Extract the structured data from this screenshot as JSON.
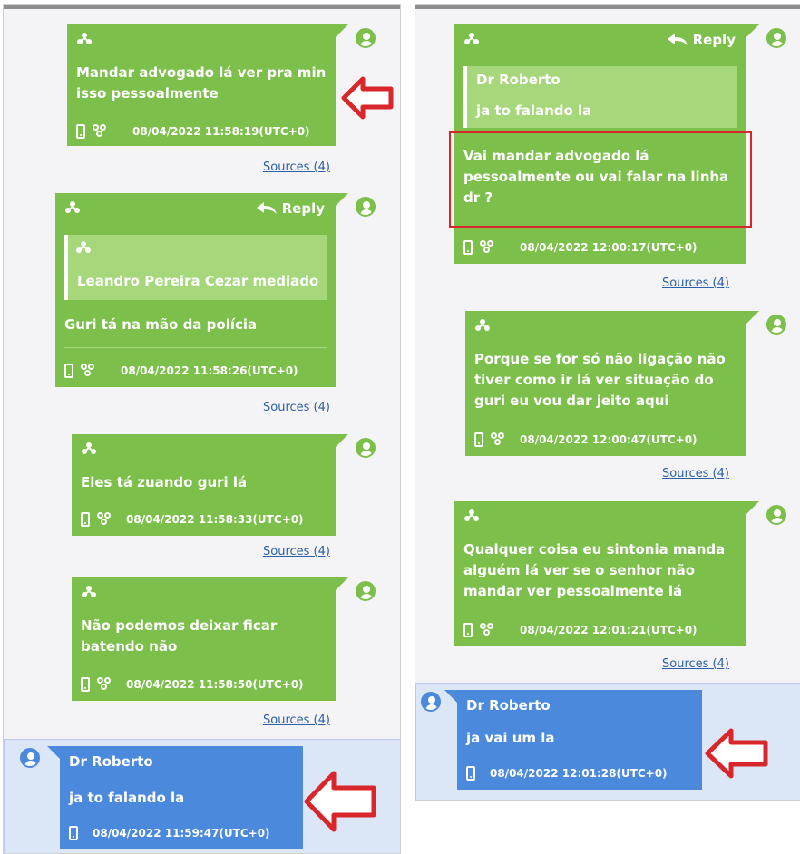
{
  "left_messages": [
    {
      "text": "Mandar advogado lá ver pra min isso pessoalmente",
      "time": "08/04/2022 11:58:19(UTC+0)",
      "sources": "Sources (4)"
    },
    {
      "reply_label": "Reply",
      "quote_name": "Leandro Pereira Cezar mediado",
      "text": "Guri tá na mão da polícia",
      "time": "08/04/2022 11:58:26(UTC+0)",
      "sources": "Sources (4)"
    },
    {
      "text": "Eles tá zuando guri lá",
      "time": "08/04/2022 11:58:33(UTC+0)",
      "sources": "Sources (4)"
    },
    {
      "text": "Não podemos deixar ficar batendo não",
      "time": "08/04/2022 11:58:50(UTC+0)",
      "sources": "Sources (4)"
    },
    {
      "name": "Dr Roberto",
      "text": "ja to falando la",
      "time": "08/04/2022 11:59:47(UTC+0)"
    }
  ],
  "right_messages": [
    {
      "reply_label": "Reply",
      "quote_name": "Dr Roberto",
      "quote_text": "ja to falando la",
      "text": "Vai mandar advogado lá pessoalmente ou vai falar na linha dr ?",
      "time": "08/04/2022 12:00:17(UTC+0)",
      "sources": "Sources (4)"
    },
    {
      "text": "Porque se for só não ligação não tiver como ir lá ver situação do guri eu vou dar jeito aqui",
      "time": "08/04/2022 12:00:47(UTC+0)",
      "sources": "Sources (4)"
    },
    {
      "text": "Qualquer coisa eu sintonia manda alguém lá ver se o senhor não mandar ver pessoalmente lá",
      "time": "08/04/2022 12:01:21(UTC+0)",
      "sources": "Sources (4)"
    },
    {
      "name": "Dr Roberto",
      "text": "ja vai um la",
      "time": "08/04/2022 12:01:28(UTC+0)"
    }
  ],
  "colors": {
    "green": "#7cbf4a",
    "blue": "#4a89dc",
    "red": "#d9262a",
    "link": "#2d5fa8"
  },
  "icons": [
    "sender-icon",
    "reply-arrow-icon",
    "phone-icon",
    "group-icon",
    "avatar-icon",
    "red-arrow-icon"
  ]
}
